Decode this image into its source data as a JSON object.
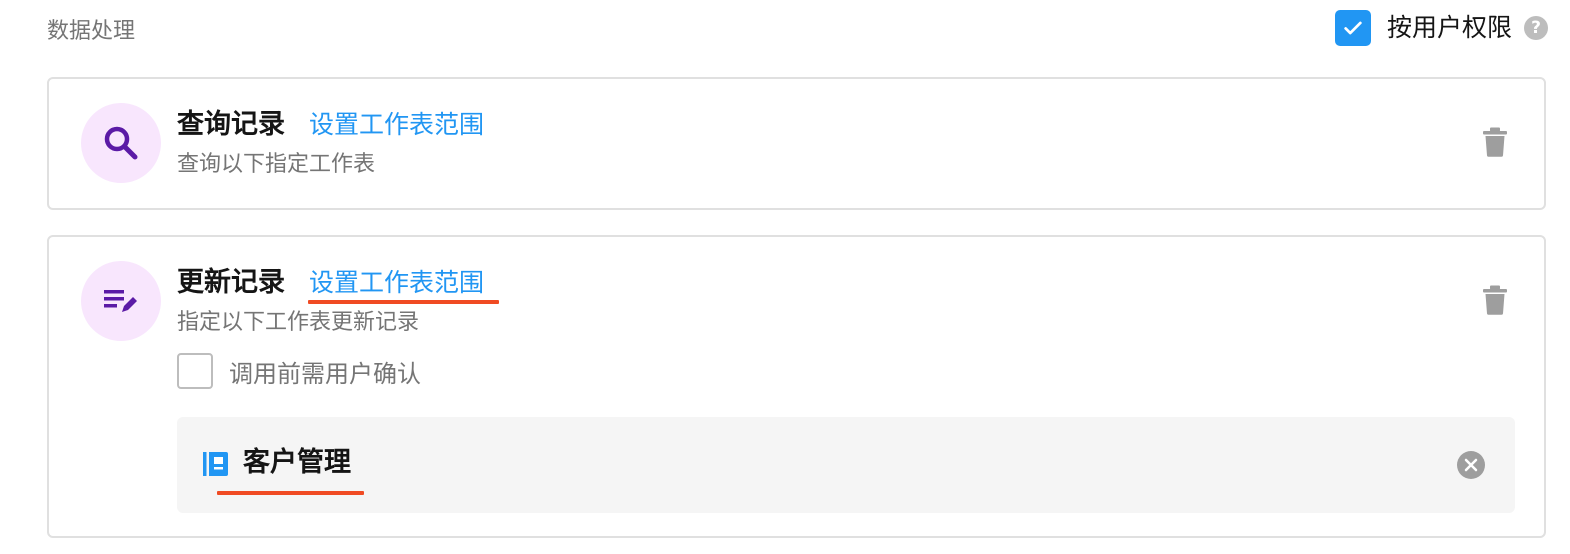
{
  "header": {
    "section_title": "数据处理",
    "permission_label": "按用户权限",
    "permission_checked": true,
    "help_symbol": "?"
  },
  "actions": [
    {
      "icon": "search-icon",
      "title": "查询记录",
      "link": "设置工作表范围",
      "description": "查询以下指定工作表"
    },
    {
      "icon": "edit-note-icon",
      "title": "更新记录",
      "link": "设置工作表范围",
      "description": "指定以下工作表更新记录",
      "confirm_label": "调用前需用户确认",
      "confirm_checked": false,
      "worksheet": {
        "icon": "worksheet-icon",
        "name": "客户管理"
      }
    }
  ],
  "colors": {
    "accent": "#2196f3",
    "icon_purple": "#5b1aa6",
    "avatar_bg": "#f8e6fd",
    "annotation": "#f04b23"
  }
}
